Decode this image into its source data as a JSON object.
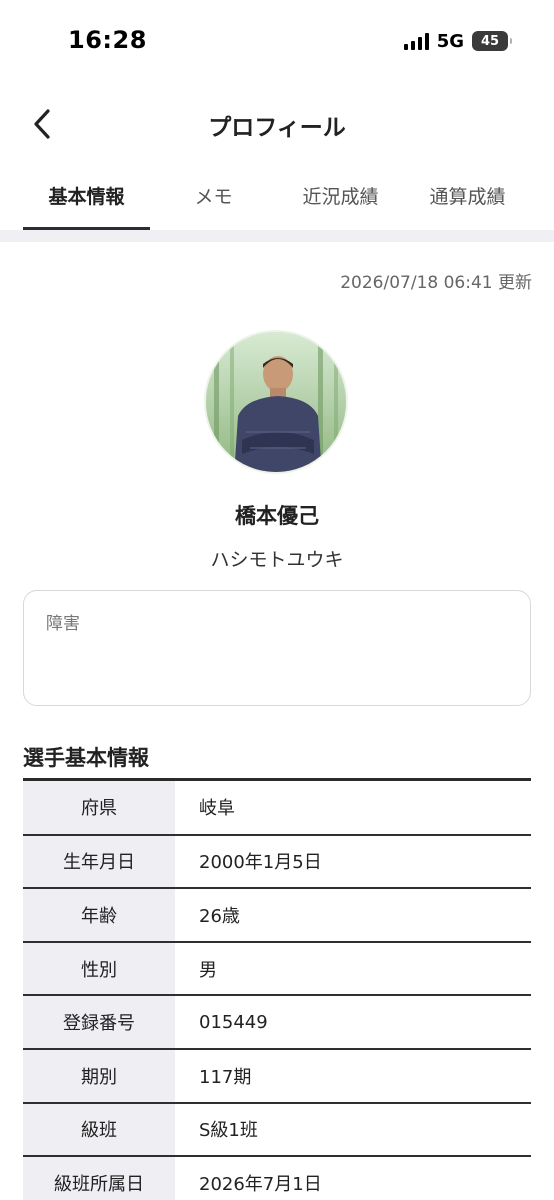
{
  "status_bar": {
    "time": "16:28",
    "network": "5G",
    "battery": "45",
    "icons": [
      "signal-icon",
      "battery-icon"
    ]
  },
  "header": {
    "title": "プロフィール",
    "back_icon": "chevron-left-icon"
  },
  "tabs": [
    {
      "label": "基本情報",
      "active": true
    },
    {
      "label": "メモ",
      "active": false
    },
    {
      "label": "近況成績",
      "active": false
    },
    {
      "label": "通算成績",
      "active": false
    }
  ],
  "updated_at": "2026/07/18 06:41 更新",
  "profile": {
    "name": "橋本優己",
    "kana": "ハシモトユウキ"
  },
  "notes": {
    "label": "障害"
  },
  "basic_info": {
    "title": "選手基本情報",
    "rows": [
      {
        "label": "府県",
        "value": "岐阜"
      },
      {
        "label": "生年月日",
        "value": "2000年1月5日"
      },
      {
        "label": "年齢",
        "value": "26歳"
      },
      {
        "label": "性別",
        "value": "男"
      },
      {
        "label": "登録番号",
        "value": "015449"
      },
      {
        "label": "期別",
        "value": "117期"
      },
      {
        "label": "級班",
        "value": "S級1班"
      },
      {
        "label": "級班所属日",
        "value": "2026年7月1日"
      }
    ]
  },
  "colors": {
    "tab_indicator": "#2b2b3a",
    "table_label_bg": "#eeeef3",
    "divider_bg": "#f0f0f4"
  }
}
